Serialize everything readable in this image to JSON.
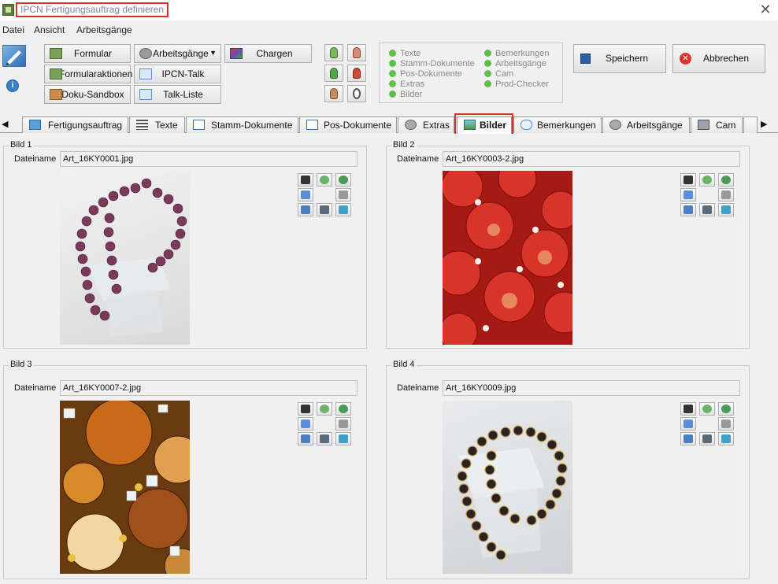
{
  "window": {
    "title": "IPCN Fertigungsauftrag definieren",
    "close_glyph": "✕"
  },
  "menu": [
    "Datei",
    "Ansicht",
    "Arbeitsgänge"
  ],
  "toolbar": {
    "formular": "Formular",
    "formularaktionen": "Formularaktionen",
    "doku_sandbox": "Doku-Sandbox",
    "arbeitsgaenge": "Arbeitsgänge",
    "ipcn_talk": "IPCN-Talk",
    "talk_liste": "Talk-Liste",
    "chargen": "Chargen",
    "speichern": "Speichern",
    "abbrechen": "Abbrechen",
    "dropdown_glyph": "▼"
  },
  "status_items_left": [
    "Texte",
    "Stamm-Dokumente",
    "Pos-Dokumente",
    "Extras",
    "Bilder"
  ],
  "status_items_right": [
    "Bemerkungen",
    "Arbeitsgänge",
    "Cam",
    "Prod-Checker"
  ],
  "tabs": [
    {
      "label": "Fertigungsauftrag",
      "icon": "order-icon"
    },
    {
      "label": "Texte",
      "icon": "text-icon"
    },
    {
      "label": "Stamm-Dokumente",
      "icon": "document-icon"
    },
    {
      "label": "Pos-Dokumente",
      "icon": "document-icon"
    },
    {
      "label": "Extras",
      "icon": "gear-icon"
    },
    {
      "label": "Bilder",
      "icon": "image-icon",
      "active": true
    },
    {
      "label": "Bemerkungen",
      "icon": "comment-icon"
    },
    {
      "label": "Arbeitsgänge",
      "icon": "gear-icon"
    },
    {
      "label": "Cam",
      "icon": "camera-icon"
    }
  ],
  "tab_arrows": {
    "left": "◀",
    "right": "▶"
  },
  "images": [
    {
      "group": "Bild 1",
      "label": "Dateiname",
      "file": "Art_16KY0001.jpg"
    },
    {
      "group": "Bild 2",
      "label": "Dateiname",
      "file": "Art_16KY0003-2.jpg"
    },
    {
      "group": "Bild 3",
      "label": "Dateiname",
      "file": "Art_16KY0007-2.jpg"
    },
    {
      "group": "Bild 4",
      "label": "Dateiname",
      "file": "Art_16KY0009.jpg"
    }
  ],
  "colors": {
    "highlight": "#d9312b",
    "status_dot": "#5fbf4a"
  }
}
